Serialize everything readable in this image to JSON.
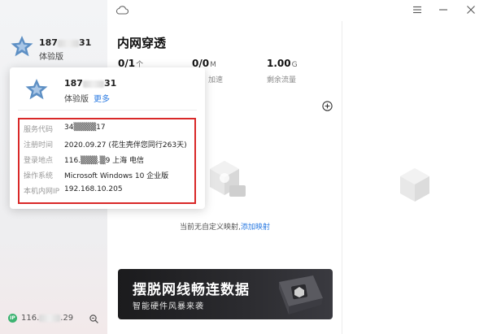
{
  "sidebar": {
    "user_prefix": "187",
    "user_suffix": "31",
    "version": "体验版",
    "ip_badge": "IP",
    "ip_prefix": "116.",
    "ip_suffix": ".29"
  },
  "main": {
    "title": "内网穿透",
    "stats": [
      {
        "value": "0/1",
        "unit": "个",
        "label": ""
      },
      {
        "value": "0/0",
        "unit": "M",
        "label": "加速"
      },
      {
        "value": "1.00",
        "unit": "G",
        "label": "剩余流量"
      }
    ],
    "empty_text": "当前无自定义映射,",
    "add_mapping_link": "添加映射"
  },
  "banner": {
    "title": "摆脱网线畅连数据",
    "subtitle": "智能硬件风暴来袭"
  },
  "popup": {
    "user_prefix": "187",
    "user_suffix": "31",
    "version": "体验版",
    "more": "更多",
    "rows": [
      {
        "key": "服务代码",
        "value": "34▒▒▒▒17"
      },
      {
        "key": "注册时间",
        "value": "2020.09.27 (花生壳伴您同行263天)"
      },
      {
        "key": "登录地点",
        "value": "116.▒▒▒.▒9 上海 电信"
      },
      {
        "key": "操作系统",
        "value": "Microsoft Windows 10 企业版"
      },
      {
        "key": "本机内网IP",
        "value": "192.168.10.205"
      }
    ]
  },
  "colors": {
    "accent": "#2a7ae2",
    "highlight": "#d92828",
    "star": "#5d8fc4"
  }
}
